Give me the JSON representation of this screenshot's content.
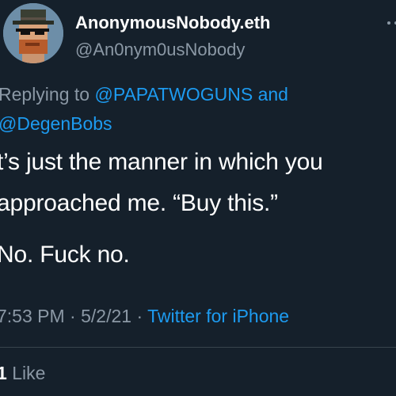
{
  "author": {
    "display_name": "AnonymousNobody.eth",
    "handle": "@An0nym0usNobody",
    "avatar_icon": "pixel-avatar-icon"
  },
  "reply": {
    "prefix": "Replying to",
    "mention1": "@PAPATWOGUNS",
    "conjunction": "and",
    "mention2": "@DegenBobs"
  },
  "tweet": {
    "line1": "t’s just the manner in which you",
    "line2": "approached me. “Buy this.”",
    "line3": "No. Fuck no."
  },
  "meta": {
    "time": "7:53 PM",
    "sep1": "·",
    "date": "5/2/21",
    "sep2": "·",
    "source": "Twitter for iPhone"
  },
  "stats": {
    "likes_count": "1",
    "likes_label": "Like"
  },
  "colors": {
    "background": "#15202b",
    "text": "#ffffff",
    "secondary": "#8b98a5",
    "link": "#1d9bf0"
  }
}
